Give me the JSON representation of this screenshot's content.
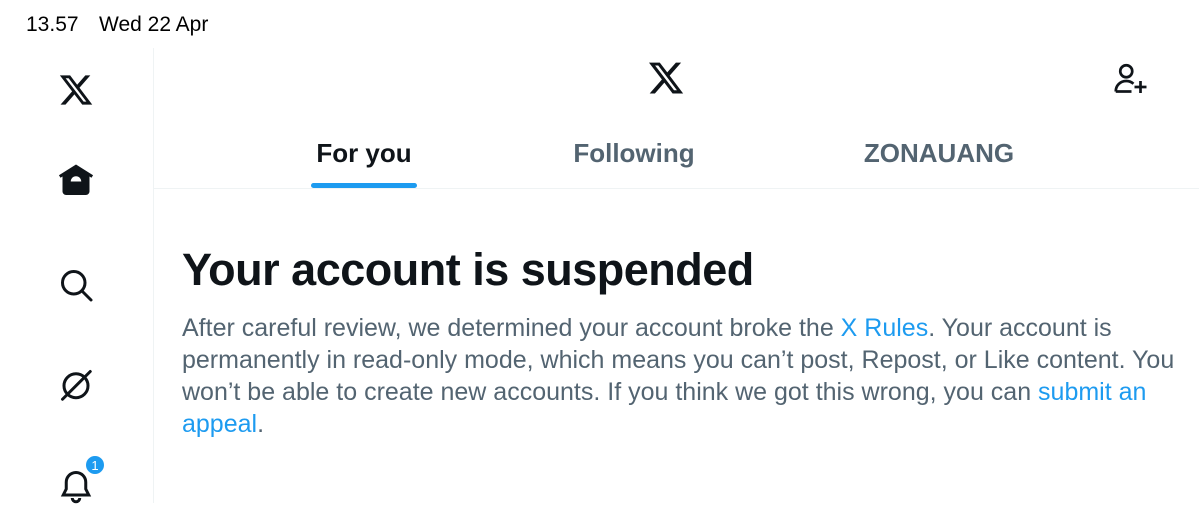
{
  "status_bar": {
    "time": "13.57",
    "date": "Wed 22 Apr"
  },
  "sidebar": {
    "items": [
      {
        "name": "x-logo-icon"
      },
      {
        "name": "home-icon"
      },
      {
        "name": "search-icon"
      },
      {
        "name": "grok-icon"
      },
      {
        "name": "notifications-icon",
        "badge": "1"
      }
    ]
  },
  "header": {
    "logo": "x-logo-icon",
    "action_icon": "add-user-icon"
  },
  "tabs": [
    {
      "label": "For you",
      "active": true
    },
    {
      "label": "Following",
      "active": false
    },
    {
      "label": "ZONAUANG",
      "active": false
    }
  ],
  "notice": {
    "title": "Your account is suspended",
    "body_part1": "After careful review, we determined your account broke the ",
    "link_rules": "X Rules",
    "body_part2": ". Your account is permanently in read-only mode, which means you can’t post, Repost, or Like content. You won’t be able to create new accounts. If you think we got this wrong, you can ",
    "link_appeal": "submit an appeal",
    "body_part3": "."
  },
  "colors": {
    "accent": "#1d9bf0",
    "text_primary": "#0f1419",
    "text_secondary": "#536471",
    "border": "#eff3f4"
  }
}
